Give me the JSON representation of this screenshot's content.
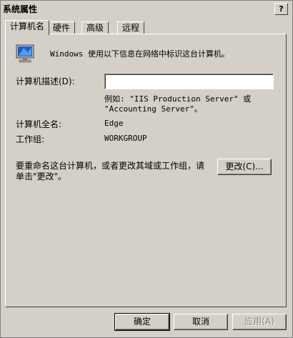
{
  "window": {
    "title": "系统属性",
    "help": "?"
  },
  "tabs": [
    {
      "label": "计算机名"
    },
    {
      "label": "硬件"
    },
    {
      "label": "高级"
    },
    {
      "label": "远程"
    }
  ],
  "intro": {
    "icon": "computer-monitor-icon",
    "text": "Windows 使用以下信息在网络中标识这台计算机。"
  },
  "description": {
    "label": "计算机描述(D):",
    "value": "",
    "example_line1": "例如: \"IIS Production Server\" 或",
    "example_line2": "\"Accounting Server\"。"
  },
  "full_name": {
    "label": "计算机全名:",
    "value": "Edge"
  },
  "workgroup": {
    "label": "工作组:",
    "value": "WORKGROUP"
  },
  "rename": {
    "text_line1": "要重命名这台计算机，或者更改其域或工作组，请",
    "text_line2": "单击\"更改\"。",
    "button": "更改(C)..."
  },
  "footer": {
    "ok": "确定",
    "cancel": "取消",
    "apply": "应用(A)"
  }
}
